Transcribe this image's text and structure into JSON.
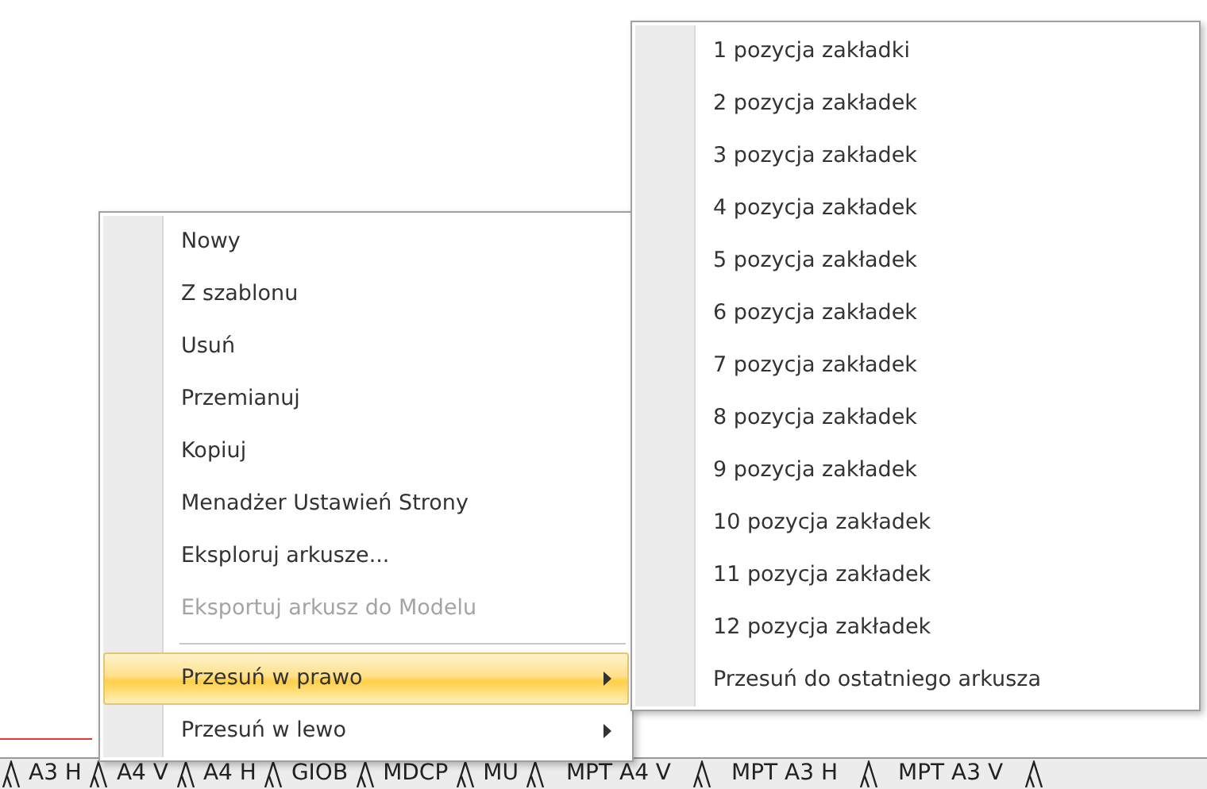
{
  "context_menu": {
    "items": [
      {
        "kind": "item",
        "label": "Nowy",
        "disabled": false,
        "selected": false,
        "submenu": false
      },
      {
        "kind": "item",
        "label": "Z szablonu",
        "disabled": false,
        "selected": false,
        "submenu": false
      },
      {
        "kind": "item",
        "label": "Usuń",
        "disabled": false,
        "selected": false,
        "submenu": false
      },
      {
        "kind": "item",
        "label": "Przemianuj",
        "disabled": false,
        "selected": false,
        "submenu": false
      },
      {
        "kind": "item",
        "label": "Kopiuj",
        "disabled": false,
        "selected": false,
        "submenu": false
      },
      {
        "kind": "item",
        "label": "Menadżer Ustawień Strony",
        "disabled": false,
        "selected": false,
        "submenu": false
      },
      {
        "kind": "item",
        "label": "Eksploruj arkusze...",
        "disabled": false,
        "selected": false,
        "submenu": false
      },
      {
        "kind": "item",
        "label": "Eksportuj arkusz do Modelu",
        "disabled": true,
        "selected": false,
        "submenu": false
      },
      {
        "kind": "separator"
      },
      {
        "kind": "item",
        "label": "Przesuń w prawo",
        "disabled": false,
        "selected": true,
        "submenu": true
      },
      {
        "kind": "item",
        "label": "Przesuń w lewo",
        "disabled": false,
        "selected": false,
        "submenu": true
      }
    ]
  },
  "submenu": {
    "items": [
      {
        "label": "1 pozycja zakładki"
      },
      {
        "label": "2 pozycja zakładek"
      },
      {
        "label": "3 pozycja zakładek"
      },
      {
        "label": "4 pozycja zakładek"
      },
      {
        "label": "5 pozycja zakładek"
      },
      {
        "label": "6 pozycja zakładek"
      },
      {
        "label": "7 pozycja zakładek"
      },
      {
        "label": "8 pozycja zakładek"
      },
      {
        "label": "9 pozycja zakładek"
      },
      {
        "label": "10 pozycja zakładek"
      },
      {
        "label": "11 pozycja zakładek"
      },
      {
        "label": "12 pozycja zakładek"
      },
      {
        "label": "Przesuń do ostatniego arkusza"
      }
    ]
  },
  "sheet_tabs": [
    {
      "label": "A3 H"
    },
    {
      "label": "A4 V"
    },
    {
      "label": "A4 H"
    },
    {
      "label": "GIOB"
    },
    {
      "label": "MDCP"
    },
    {
      "label": "MU"
    },
    {
      "label": "MPT A4 V"
    },
    {
      "label": "MPT A3 H"
    },
    {
      "label": "MPT A3 V"
    }
  ]
}
